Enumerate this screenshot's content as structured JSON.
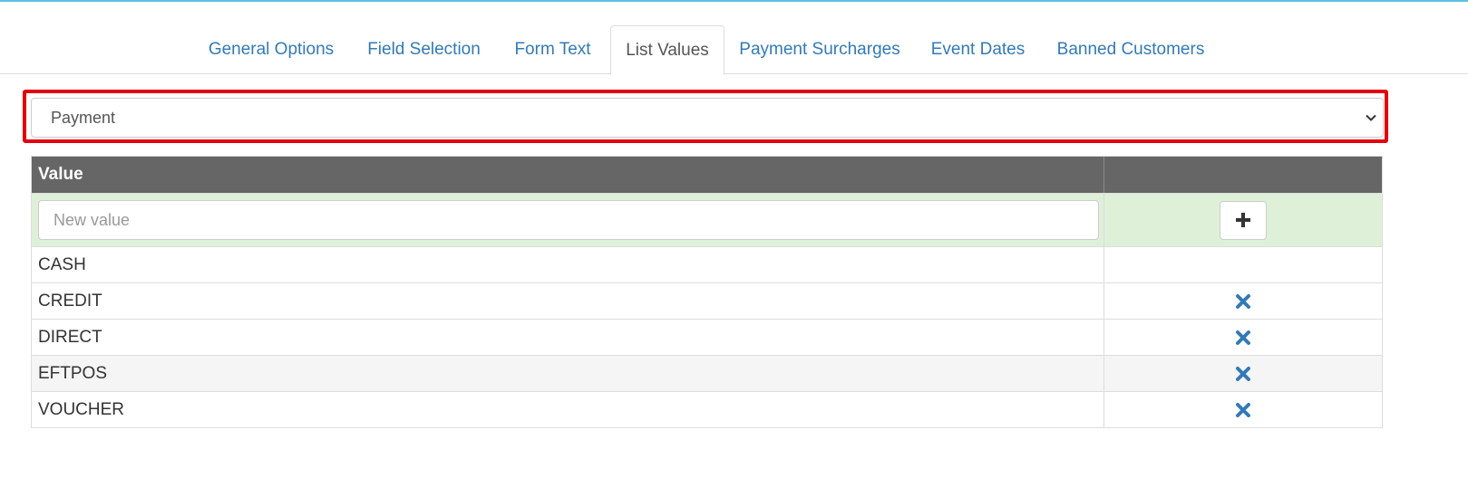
{
  "tabs": [
    {
      "label": "General Options",
      "active": false
    },
    {
      "label": "Field Selection",
      "active": false
    },
    {
      "label": "Form Text",
      "active": false
    },
    {
      "label": "List Values",
      "active": true
    },
    {
      "label": "Payment Surcharges",
      "active": false
    },
    {
      "label": "Event Dates",
      "active": false
    },
    {
      "label": "Banned Customers",
      "active": false
    }
  ],
  "list_select": {
    "selected": "Payment"
  },
  "table": {
    "header_value": "Value",
    "header_action": "",
    "new_value_placeholder": "New value",
    "add_icon": "plus-icon",
    "delete_icon": "remove-icon",
    "rows": [
      {
        "value": "CASH",
        "deletable": false
      },
      {
        "value": "CREDIT",
        "deletable": true
      },
      {
        "value": "DIRECT",
        "deletable": true
      },
      {
        "value": "EFTPOS",
        "deletable": true
      },
      {
        "value": "VOUCHER",
        "deletable": true
      }
    ]
  },
  "colors": {
    "link": "#337ab7",
    "header_bg": "#666666",
    "new_row_bg": "#dff0d8",
    "highlight": "#e3000f"
  }
}
